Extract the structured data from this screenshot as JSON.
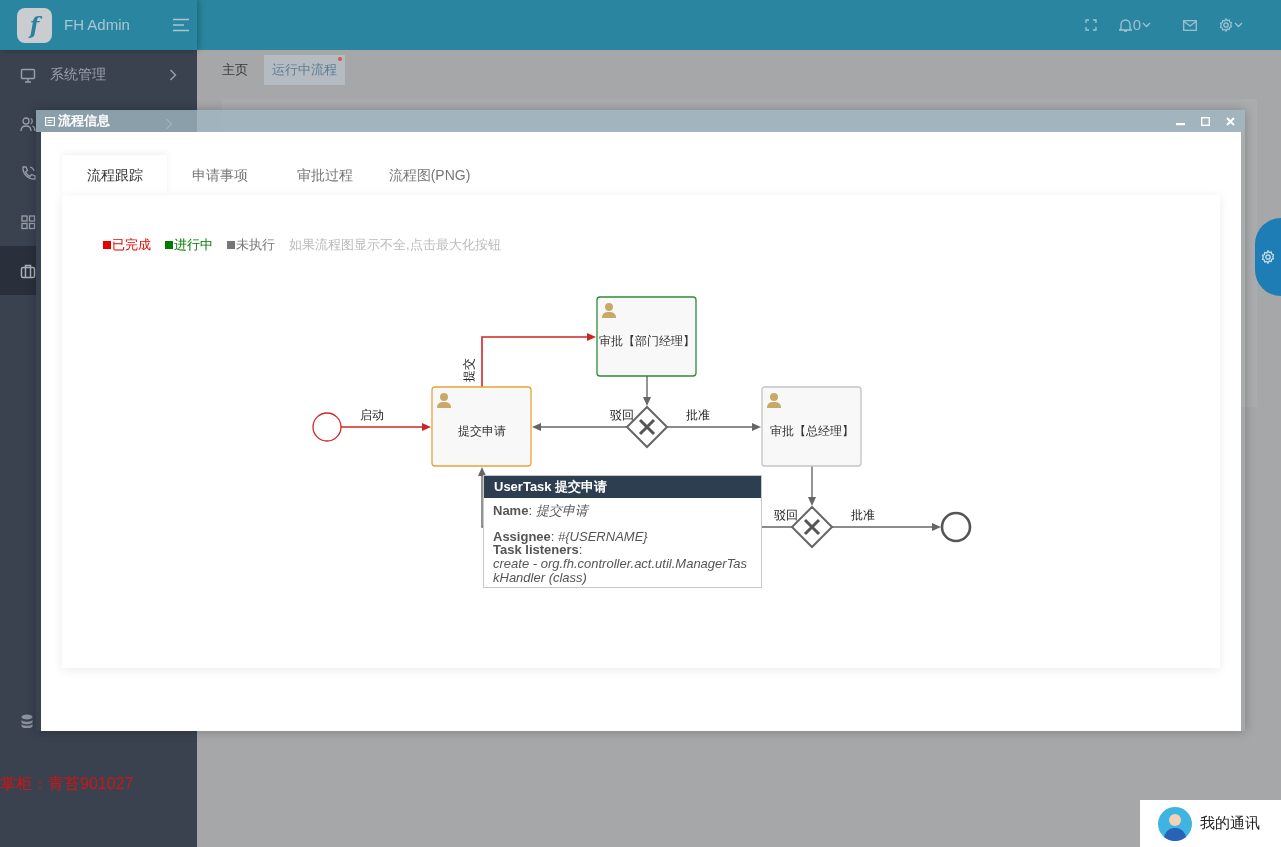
{
  "sidebar": {
    "logo": "f",
    "brand": "FH Admin",
    "items": [
      {
        "label": "系统管理",
        "selected": false
      },
      {
        "selected": false
      },
      {
        "selected": false
      },
      {
        "selected": false
      },
      {
        "selected": true
      }
    ],
    "note": "掌柜：青苔901027"
  },
  "header": {
    "notifications": "0"
  },
  "page_tabs": [
    {
      "label": "主页",
      "selected": false
    },
    {
      "label": "运行中流程",
      "selected": true
    }
  ],
  "dialog": {
    "title": "流程信息",
    "tabs": [
      {
        "label": "流程跟踪",
        "selected": true
      },
      {
        "label": "申请事项",
        "selected": false
      },
      {
        "label": "审批过程",
        "selected": false
      },
      {
        "label": "流程图(PNG)",
        "selected": false
      }
    ],
    "legend": [
      {
        "label": "已完成",
        "color": "#e60000"
      },
      {
        "label": "进行中",
        "color": "#007a00"
      },
      {
        "label": "未执行",
        "color": "#777777"
      }
    ],
    "hint": "如果流程图显示不全,点击最大化按钮",
    "diagram": {
      "nodes": [
        {
          "kind": "start"
        },
        {
          "kind": "task",
          "label": "提交申请",
          "color": "#e8a33d"
        },
        {
          "kind": "task",
          "label": "审批【部门经理】",
          "color": "#2e8b3a"
        },
        {
          "kind": "gateway"
        },
        {
          "kind": "task",
          "label": "审批【总经理】",
          "color": "#c4c4c4"
        },
        {
          "kind": "gateway"
        },
        {
          "kind": "end"
        }
      ],
      "flows": [
        {
          "label": "启动",
          "completed": true
        },
        {
          "label": "提交",
          "completed": true
        },
        {
          "completed": false
        },
        {
          "label": "驳回",
          "completed": false
        },
        {
          "label": "批准",
          "completed": false
        },
        {
          "completed": false
        },
        {
          "label": "驳回",
          "completed": false
        },
        {
          "label": "批准",
          "completed": false
        }
      ]
    },
    "tooltip": {
      "title": "UserTask 提交申请",
      "lines": [
        "**Name**: *提交申请*",
        "**Assignee**: *#{USERNAME}*",
        "**Task listeners**:",
        "*create - org.fh.controller.act.util.ManagerTaskHandler (class)*"
      ]
    }
  },
  "chat_widget": {
    "label": "我的通讯"
  }
}
